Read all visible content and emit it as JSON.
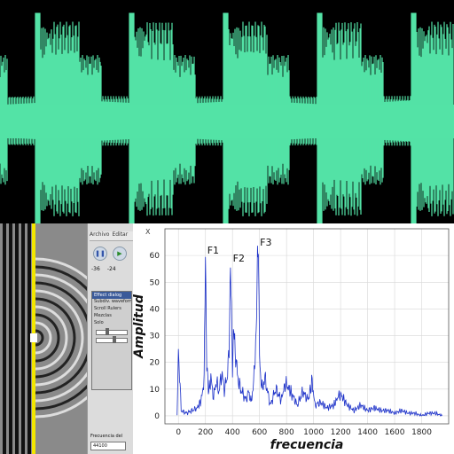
{
  "app_panel": {
    "menu": [
      "Archivo",
      "Editar"
    ],
    "play_controls": {
      "pause_glyph": "❚❚",
      "play_glyph": "▶"
    },
    "meter_labels": [
      "-36",
      "-24"
    ],
    "effect_panel": {
      "title": "Effect dialog",
      "lines": [
        "Subdiv. waveform",
        "Scroll Rulers",
        "Mezclas",
        "Solo"
      ]
    },
    "rate_label": "Frecuencia del",
    "rate_value": "44100"
  },
  "chart_data": {
    "type": "line",
    "xlabel": "frecuencia",
    "ylabel": "Amplitud",
    "axis_corner_label": "X",
    "xlim": [
      -100,
      2000
    ],
    "ylim": [
      -3,
      70
    ],
    "x_ticks": [
      0,
      200,
      400,
      600,
      800,
      1000,
      1200,
      1400,
      1600,
      1800
    ],
    "y_ticks": [
      0,
      10,
      20,
      30,
      40,
      50,
      60
    ],
    "grid": true,
    "series_color": "#1a2fc8",
    "annotations": [
      {
        "text": "F1",
        "x": 200,
        "y": 60
      },
      {
        "text": "F2",
        "x": 390,
        "y": 57
      },
      {
        "text": "F3",
        "x": 590,
        "y": 63
      }
    ],
    "series": [
      {
        "x": [
          -10,
          0,
          20,
          60,
          100,
          140,
          170,
          190,
          200,
          210,
          225,
          240,
          260,
          280,
          300,
          320,
          340,
          360,
          375,
          385,
          392,
          400,
          410,
          420,
          440,
          460,
          480,
          500,
          520,
          540,
          560,
          575,
          585,
          592,
          600,
          615,
          640,
          680,
          720,
          760,
          790,
          810,
          840,
          880,
          920,
          960,
          990,
          1010,
          1050,
          1100,
          1150,
          1180,
          1200,
          1250,
          1300,
          1350,
          1400,
          1450,
          1500,
          1550,
          1600,
          1650,
          1700,
          1750,
          1800,
          1850,
          1900,
          1950
        ],
        "y": [
          0,
          25,
          2,
          1,
          2,
          3,
          6,
          14,
          60,
          18,
          9,
          14,
          7,
          13,
          9,
          16,
          10,
          14,
          25,
          57,
          40,
          18,
          34,
          24,
          14,
          10,
          8,
          6,
          9,
          5,
          15,
          30,
          60,
          63,
          22,
          10,
          14,
          4,
          10,
          6,
          12,
          11,
          8,
          4,
          9,
          6,
          13,
          4,
          5,
          3,
          4,
          7,
          8,
          4,
          2,
          4,
          2,
          3,
          2,
          2,
          1,
          2,
          1,
          1,
          0,
          1,
          1,
          0
        ]
      }
    ]
  }
}
